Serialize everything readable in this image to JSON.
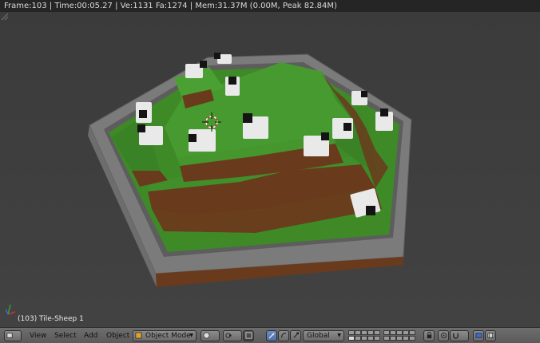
{
  "info_bar": {
    "text": "Frame:103 | Time:00:05.27 | Ve:1131 Fa:1274 | Mem:31.37M (0.00M, Peak 82.84M)"
  },
  "viewport": {
    "object_label": "(103) Tile-Sheep 1"
  },
  "header": {
    "menus": {
      "view": "View",
      "select": "Select",
      "add": "Add",
      "object": "Object"
    },
    "mode": "Object Mode",
    "orientation": "Global"
  },
  "colors": {
    "grass": "#3f8a2a",
    "dirt": "#6b3a1c",
    "stone": "#7a7a7a",
    "wool": "#e9e9e9",
    "sheep_head": "#141414",
    "active_button": "#5577b6"
  },
  "icons": [
    "editor-type-icon",
    "viewport-shading-icon",
    "pivot-icon",
    "snap-manipulator-icon",
    "translate-icon",
    "rotate-icon",
    "scale-icon",
    "lock-camera-icon",
    "proportional-icon",
    "snap-icon",
    "render-icon",
    "render-animation-icon",
    "axis-gizmo-icon",
    "3d-cursor-icon"
  ]
}
